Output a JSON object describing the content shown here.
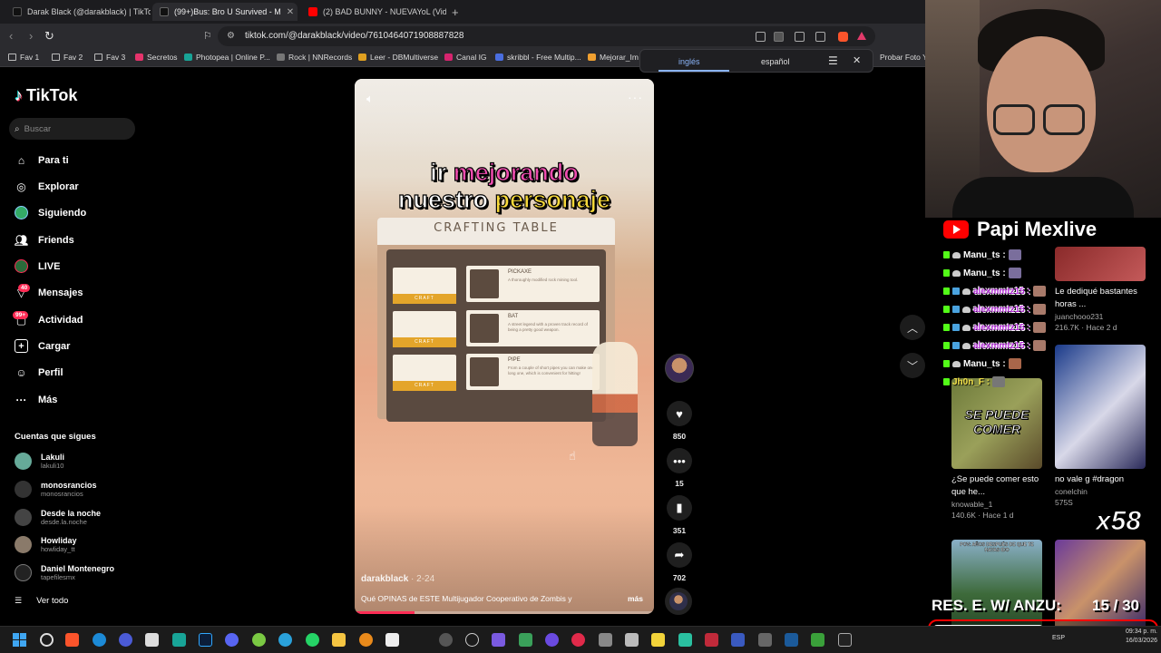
{
  "browser": {
    "tabs": [
      {
        "title": "Darak Black (@darakblack) | TikTok"
      },
      {
        "title": "(99+)Bus: Bro U Survived - M"
      },
      {
        "title": "(2) BAD BUNNY - NUEVAYoL (Video C"
      }
    ],
    "url": "tiktok.com/@darakblack/video/7610464071908887828",
    "bookmarks": [
      "Fav 1",
      "Fav 2",
      "Fav 3",
      "Secretos",
      "Photopea | Online P...",
      "Rock | NNRecords",
      "Leer - DBMultiverse",
      "Canal IG",
      "skribbl - Free Multip...",
      "Mejorar_Im",
      "Probar Foto Y"
    ],
    "translate": {
      "from": "inglés",
      "to": "español"
    }
  },
  "tiktok": {
    "logo": "TikTok",
    "search_placeholder": "Buscar",
    "nav": [
      {
        "label": "Para ti",
        "icon": "home-icon"
      },
      {
        "label": "Explorar",
        "icon": "compass-icon"
      },
      {
        "label": "Siguiendo",
        "icon": "following-avatar-icon"
      },
      {
        "label": "Friends",
        "icon": "friends-icon"
      },
      {
        "label": "LIVE",
        "icon": "live-icon"
      },
      {
        "label": "Mensajes",
        "icon": "message-icon",
        "badge": "40"
      },
      {
        "label": "Actividad",
        "icon": "activity-icon",
        "badge": "99+"
      },
      {
        "label": "Cargar",
        "icon": "upload-icon"
      },
      {
        "label": "Perfil",
        "icon": "profile-icon"
      },
      {
        "label": "Más",
        "icon": "more-icon"
      }
    ],
    "following_heading": "Cuentas que sigues",
    "following": [
      {
        "name": "Lakuli",
        "handle": "lakuli10"
      },
      {
        "name": "monosrancios",
        "handle": "monosrancios"
      },
      {
        "name": "Desde la noche",
        "handle": "desde.la.noche"
      },
      {
        "name": "Howliday",
        "handle": "howliday_tt"
      },
      {
        "name": "Daniel Montenegro",
        "handle": "tapefilesmx"
      }
    ],
    "see_all": "Ver todo",
    "video": {
      "caption_line1_a": "ir ",
      "caption_line1_b": "mejorando",
      "caption_line2_a": "nuestro ",
      "caption_line2_b": "personaje",
      "crafting_title": "CRAFTING TABLE",
      "craft_button": "CRAFT",
      "items": [
        {
          "name": "PICKAXE",
          "desc": "A thoroughly modified rock mining tool."
        },
        {
          "name": "BAT",
          "desc": "A street legend with a proven track record of being a pretty good weapon."
        },
        {
          "name": "PIPE",
          "desc": "From a couple of short pipes you can make one long one, which is convenient for hitting!"
        }
      ],
      "author": "darakblack",
      "date": "2-24",
      "description": "Qué OPINAS de ESTE Multijugador Cooperativo de Zombis y",
      "more": "más",
      "progress": 0.2
    },
    "actions": {
      "likes": "850",
      "comments": "15",
      "saves": "351",
      "shares": "702"
    }
  },
  "stream": {
    "channel": "Papi Mexlive",
    "chat": [
      {
        "user": "Manu_ts :",
        "style": "white"
      },
      {
        "user": "Manu_ts :",
        "style": "white"
      },
      {
        "user": "alexmmtz15 :",
        "style": "pink"
      },
      {
        "user": "alexmmtz15 :",
        "style": "pink"
      },
      {
        "user": "alexmmtz15 :",
        "style": "pink"
      },
      {
        "user": "alexmmtz15 :",
        "style": "pink"
      },
      {
        "user": "Manu_ts :",
        "style": "white"
      },
      {
        "user": "Jh0n_F :",
        "style": "yellow"
      }
    ],
    "multiplier": "x58",
    "res_label": "RES. E. W/ ANZU:",
    "res_count": "15 / 30",
    "res_progress": 0.5
  },
  "feed": [
    {
      "title": "Le dediqué bastantes horas ...",
      "user": "juanchooo231",
      "stat": "216.7K · Hace 2 d"
    },
    {
      "title": "¿Se puede comer esto que he...",
      "user": "knowable_1",
      "stat": "140.6K · Hace 1 d",
      "overlay": "SE PUEDE COMER"
    },
    {
      "title": "no vale g #dragon",
      "user": "conelchin",
      "stat": "575S"
    },
    {
      "title": "",
      "user": "",
      "stat": "",
      "overlay": "POV: AÑOS DESPUÉS DE QUE TE HAYAS IDO"
    }
  ],
  "system": {
    "lang": "ESP",
    "time": "09:34 p. m.",
    "date": "16/03/2026"
  }
}
